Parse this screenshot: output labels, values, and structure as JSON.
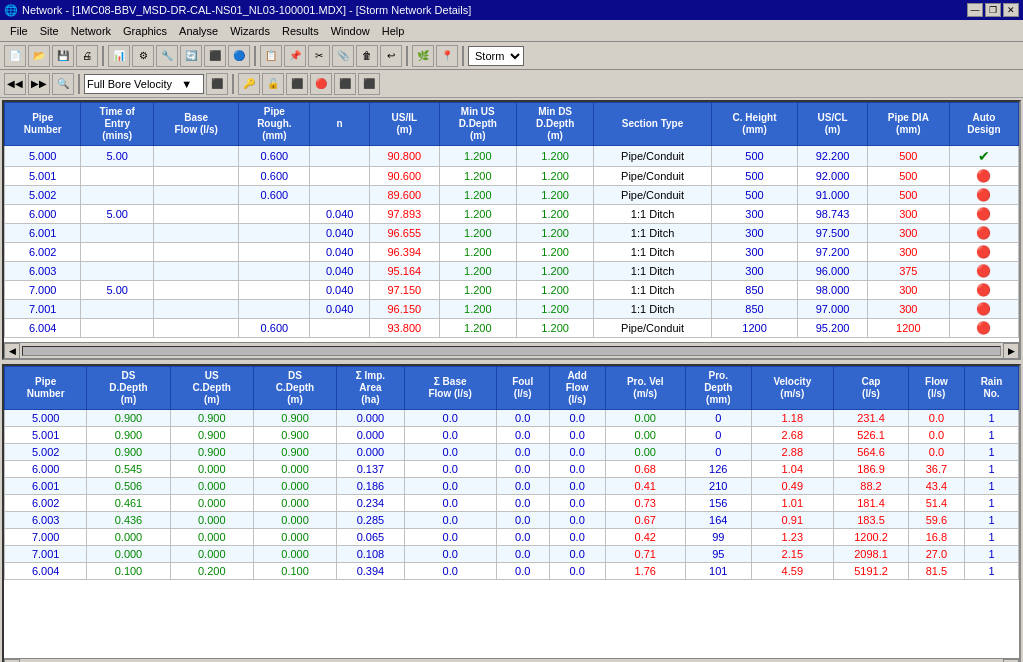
{
  "titleBar": {
    "title": "Network - [1MC08-BBV_MSD-DR-CAL-NS01_NL03-100001.MDX] - [Storm Network Details]",
    "controls": [
      "—",
      "❐",
      "✕"
    ]
  },
  "menuBar": {
    "items": [
      "File",
      "Site",
      "Network",
      "Graphics",
      "Analyse",
      "Wizards",
      "Results",
      "Window",
      "Help"
    ]
  },
  "toolbar": {
    "stormLabel": "Storm"
  },
  "topTable": {
    "headers": [
      "Pipe\nNumber",
      "Time of\nEntry\n(mins)",
      "Base\nFlow (l/s)",
      "Pipe\nRough.\n(mm)",
      "n",
      "US/IL\n(m)",
      "Min US\nD.Depth\n(m)",
      "Min DS\nD.Depth\n(m)",
      "Section Type",
      "C. Height\n(mm)",
      "US/CL\n(m)",
      "Pipe DIA\n(mm)",
      "Auto\nDesign"
    ],
    "rows": [
      {
        "pipe": "5.000",
        "timeEntry": "5.00",
        "baseFlow": "",
        "pipeRough": "0.600",
        "n": "",
        "usil": "90.800",
        "minUS": "1.200",
        "minDS": "1.200",
        "sectionType": "Pipe/Conduit",
        "cHeight": "500",
        "uscl": "92.200",
        "pipeDia": "500",
        "auto": "✓",
        "autoColor": "green"
      },
      {
        "pipe": "5.001",
        "timeEntry": "",
        "baseFlow": "",
        "pipeRough": "0.600",
        "n": "",
        "usil": "90.600",
        "minUS": "1.200",
        "minDS": "1.200",
        "sectionType": "Pipe/Conduit",
        "cHeight": "500",
        "uscl": "92.000",
        "pipeDia": "500",
        "auto": "🔴",
        "autoColor": "red"
      },
      {
        "pipe": "5.002",
        "timeEntry": "",
        "baseFlow": "",
        "pipeRough": "0.600",
        "n": "",
        "usil": "89.600",
        "minUS": "1.200",
        "minDS": "1.200",
        "sectionType": "Pipe/Conduit",
        "cHeight": "500",
        "uscl": "91.000",
        "pipeDia": "500",
        "auto": "🔴",
        "autoColor": "red"
      },
      {
        "pipe": "6.000",
        "timeEntry": "5.00",
        "baseFlow": "",
        "pipeRough": "",
        "n": "0.040",
        "usil": "97.893",
        "minUS": "1.200",
        "minDS": "1.200",
        "sectionType": "1:1 Ditch",
        "cHeight": "300",
        "uscl": "98.743",
        "pipeDia": "300",
        "auto": "🔴",
        "autoColor": "red"
      },
      {
        "pipe": "6.001",
        "timeEntry": "",
        "baseFlow": "",
        "pipeRough": "",
        "n": "0.040",
        "usil": "96.655",
        "minUS": "1.200",
        "minDS": "1.200",
        "sectionType": "1:1 Ditch",
        "cHeight": "300",
        "uscl": "97.500",
        "pipeDia": "300",
        "auto": "🔴",
        "autoColor": "red"
      },
      {
        "pipe": "6.002",
        "timeEntry": "",
        "baseFlow": "",
        "pipeRough": "",
        "n": "0.040",
        "usil": "96.394",
        "minUS": "1.200",
        "minDS": "1.200",
        "sectionType": "1:1 Ditch",
        "cHeight": "300",
        "uscl": "97.200",
        "pipeDia": "300",
        "auto": "🔴",
        "autoColor": "red"
      },
      {
        "pipe": "6.003",
        "timeEntry": "",
        "baseFlow": "",
        "pipeRough": "",
        "n": "0.040",
        "usil": "95.164",
        "minUS": "1.200",
        "minDS": "1.200",
        "sectionType": "1:1 Ditch",
        "cHeight": "300",
        "uscl": "96.000",
        "pipeDia": "375",
        "auto": "🔴",
        "autoColor": "red"
      },
      {
        "pipe": "7.000",
        "timeEntry": "5.00",
        "baseFlow": "",
        "pipeRough": "",
        "n": "0.040",
        "usil": "97.150",
        "minUS": "1.200",
        "minDS": "1.200",
        "sectionType": "1:1 Ditch",
        "cHeight": "850",
        "uscl": "98.000",
        "pipeDia": "300",
        "auto": "🔴",
        "autoColor": "red"
      },
      {
        "pipe": "7.001",
        "timeEntry": "",
        "baseFlow": "",
        "pipeRough": "",
        "n": "0.040",
        "usil": "96.150",
        "minUS": "1.200",
        "minDS": "1.200",
        "sectionType": "1:1 Ditch",
        "cHeight": "850",
        "uscl": "97.000",
        "pipeDia": "300",
        "auto": "🔴",
        "autoColor": "red"
      },
      {
        "pipe": "6.004",
        "timeEntry": "",
        "baseFlow": "",
        "pipeRough": "0.600",
        "n": "",
        "usil": "93.800",
        "minUS": "1.200",
        "minDS": "1.200",
        "sectionType": "Pipe/Conduit",
        "cHeight": "1200",
        "uscl": "95.200",
        "pipeDia": "1200",
        "auto": "🔴",
        "autoColor": "red"
      }
    ]
  },
  "bottomTable": {
    "headers": [
      "Pipe\nNumber",
      "DS\nD.Depth\n(m)",
      "US\nC.Depth\n(m)",
      "DS\nC.Depth\n(m)",
      "Σ Imp.\nArea\n(ha)",
      "Σ Base\nFlow (l/s)",
      "Foul\n(l/s)",
      "Add\nFlow\n(l/s)",
      "Pro. Vel\n(m/s)",
      "Pro.\nDepth\n(mm)",
      "Velocity\n(m/s)",
      "Cap\n(l/s)",
      "Flow\n(l/s)",
      "Rain\nNo."
    ],
    "rows": [
      {
        "pipe": "5.000",
        "dsDdepth": "0.900",
        "usCdepth": "0.900",
        "dsCdepth": "0.900",
        "sigmaImp": "0.000",
        "sigmaBase": "0.0",
        "foul": "0.0",
        "addFlow": "0.0",
        "proVel": "0.00",
        "proDepth": "0",
        "velocity": "1.18",
        "cap": "231.4",
        "flow": "0.0",
        "rain": "1"
      },
      {
        "pipe": "5.001",
        "dsDdepth": "0.900",
        "usCdepth": "0.900",
        "dsCdepth": "0.900",
        "sigmaImp": "0.000",
        "sigmaBase": "0.0",
        "foul": "0.0",
        "addFlow": "0.0",
        "proVel": "0.00",
        "proDepth": "0",
        "velocity": "2.68",
        "cap": "526.1",
        "flow": "0.0",
        "rain": "1"
      },
      {
        "pipe": "5.002",
        "dsDdepth": "0.900",
        "usCdepth": "0.900",
        "dsCdepth": "0.900",
        "sigmaImp": "0.000",
        "sigmaBase": "0.0",
        "foul": "0.0",
        "addFlow": "0.0",
        "proVel": "0.00",
        "proDepth": "0",
        "velocity": "2.88",
        "cap": "564.6",
        "flow": "0.0",
        "rain": "1"
      },
      {
        "pipe": "6.000",
        "dsDdepth": "0.545",
        "usCdepth": "0.000",
        "dsCdepth": "0.000",
        "sigmaImp": "0.137",
        "sigmaBase": "0.0",
        "foul": "0.0",
        "addFlow": "0.0",
        "proVel": "0.68",
        "proDepth": "126",
        "velocity": "1.04",
        "cap": "186.9",
        "flow": "36.7",
        "rain": "1"
      },
      {
        "pipe": "6.001",
        "dsDdepth": "0.506",
        "usCdepth": "0.000",
        "dsCdepth": "0.000",
        "sigmaImp": "0.186",
        "sigmaBase": "0.0",
        "foul": "0.0",
        "addFlow": "0.0",
        "proVel": "0.41",
        "proDepth": "210",
        "velocity": "0.49",
        "cap": "88.2",
        "flow": "43.4",
        "rain": "1"
      },
      {
        "pipe": "6.002",
        "dsDdepth": "0.461",
        "usCdepth": "0.000",
        "dsCdepth": "0.000",
        "sigmaImp": "0.234",
        "sigmaBase": "0.0",
        "foul": "0.0",
        "addFlow": "0.0",
        "proVel": "0.73",
        "proDepth": "156",
        "velocity": "1.01",
        "cap": "181.4",
        "flow": "51.4",
        "rain": "1"
      },
      {
        "pipe": "6.003",
        "dsDdepth": "0.436",
        "usCdepth": "0.000",
        "dsCdepth": "0.000",
        "sigmaImp": "0.285",
        "sigmaBase": "0.0",
        "foul": "0.0",
        "addFlow": "0.0",
        "proVel": "0.67",
        "proDepth": "164",
        "velocity": "0.91",
        "cap": "183.5",
        "flow": "59.6",
        "rain": "1"
      },
      {
        "pipe": "7.000",
        "dsDdepth": "0.000",
        "usCdepth": "0.000",
        "dsCdepth": "0.000",
        "sigmaImp": "0.065",
        "sigmaBase": "0.0",
        "foul": "0.0",
        "addFlow": "0.0",
        "proVel": "0.42",
        "proDepth": "99",
        "velocity": "1.23",
        "cap": "1200.2",
        "flow": "16.8",
        "rain": "1"
      },
      {
        "pipe": "7.001",
        "dsDdepth": "0.000",
        "usCdepth": "0.000",
        "dsCdepth": "0.000",
        "sigmaImp": "0.108",
        "sigmaBase": "0.0",
        "foul": "0.0",
        "addFlow": "0.0",
        "proVel": "0.71",
        "proDepth": "95",
        "velocity": "2.15",
        "cap": "2098.1",
        "flow": "27.0",
        "rain": "1"
      },
      {
        "pipe": "6.004",
        "dsDdepth": "0.100",
        "usCdepth": "0.200",
        "dsCdepth": "0.100",
        "sigmaImp": "0.394",
        "sigmaBase": "0.0",
        "foul": "0.0",
        "addFlow": "0.0",
        "proVel": "1.76",
        "proDepth": "101",
        "velocity": "4.59",
        "cap": "5191.2",
        "flow": "81.5",
        "rain": "1"
      }
    ]
  }
}
